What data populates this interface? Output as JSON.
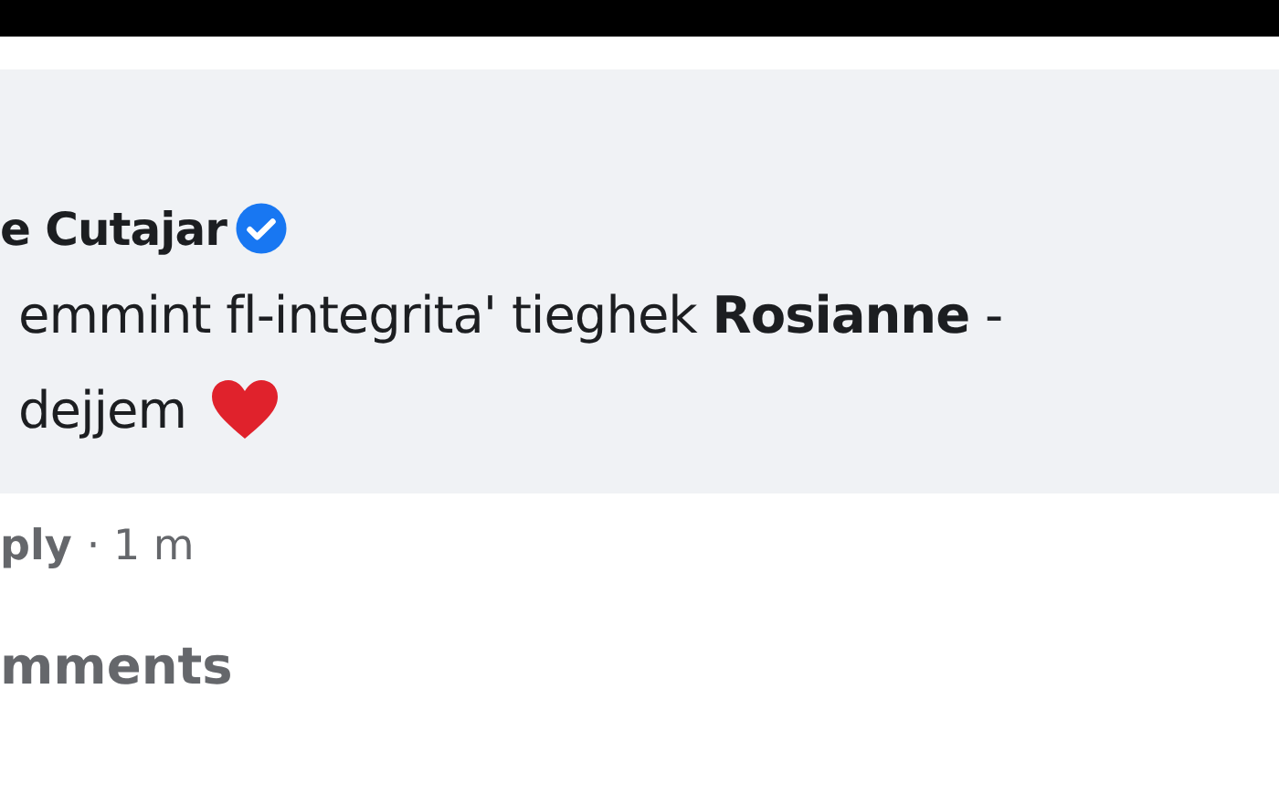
{
  "comment": {
    "author": "e Cutajar",
    "verified": true,
    "lines": [
      "emmint fl-integrita' tieghek **Rosianne** -",
      "dejjem"
    ],
    "heart": true
  },
  "actions": {
    "reply": "ply",
    "time": "· 1 m"
  },
  "section_title": "mments"
}
